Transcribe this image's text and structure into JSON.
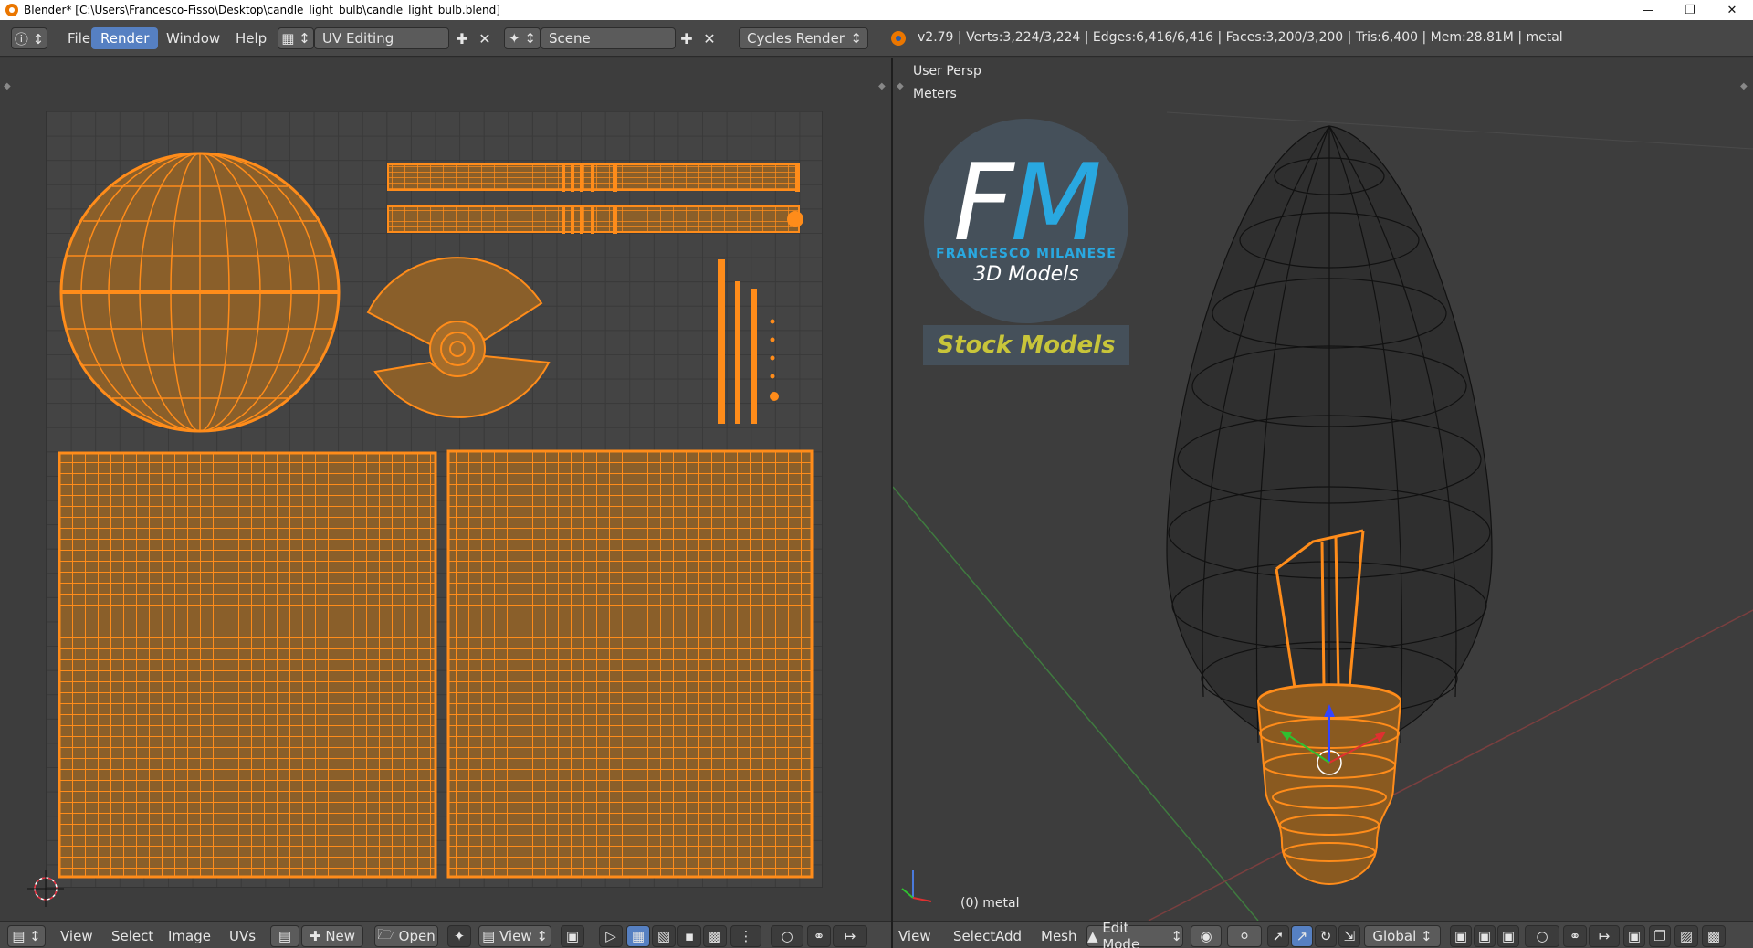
{
  "window": {
    "title": "Blender* [C:\\Users\\Francesco-Fisso\\Desktop\\candle_light_bulb\\candle_light_bulb.blend]",
    "minimize_icon": "minimize-icon",
    "maximize_icon": "restore-icon",
    "close_icon": "close-icon"
  },
  "header": {
    "menus": [
      "File",
      "Render",
      "Window",
      "Help"
    ],
    "active_menu": "Render",
    "layout": "UV Editing",
    "scene": "Scene",
    "engine": "Cycles Render",
    "stats": "v2.79 | Verts:3,224/3,224 | Edges:6,416/6,416 | Faces:3,200/3,200 | Tris:6,400 | Mem:28.81M | metal"
  },
  "viewport": {
    "view_name": "User Persp",
    "units": "Meters",
    "object_info": "(0) metal"
  },
  "logo": {
    "letter_f": "F",
    "letter_m": "M",
    "name": "FRANCESCO MILANESE",
    "tagline": "3D Models",
    "stock": "Stock Models"
  },
  "uv_footer": {
    "menus": [
      "View",
      "Select",
      "Image",
      "UVs"
    ],
    "new_label": "New",
    "open_label": "Open",
    "view_label": "View"
  },
  "view3d_footer": {
    "menus": [
      "View",
      "Select",
      "Add",
      "Mesh"
    ],
    "mode": "Edit Mode",
    "orientation": "Global"
  },
  "colors": {
    "accent": "#5680c2",
    "uv_orange": "#ff8c1a",
    "brand_blue": "#29a8e0",
    "stock_yellow": "#c8c53a"
  }
}
